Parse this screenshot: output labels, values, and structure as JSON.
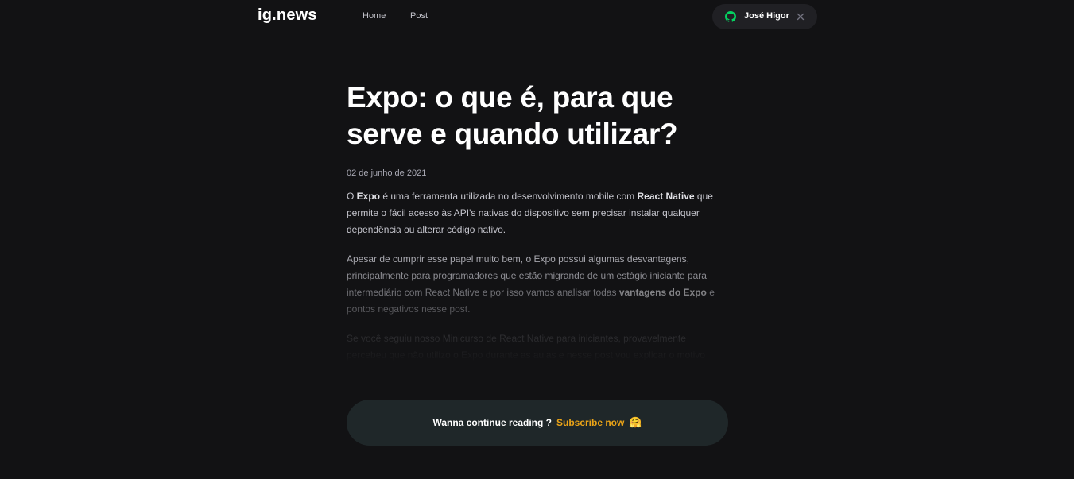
{
  "header": {
    "logo": "ig.news",
    "nav": [
      {
        "label": "Home"
      },
      {
        "label": "Post"
      }
    ],
    "user": {
      "name": "José Higor",
      "icon": "github-icon",
      "icon_color": "#04d361"
    }
  },
  "post": {
    "title": "Expo: o que é, para que serve e quando utilizar?",
    "date": "02 de junho de 2021",
    "paragraphs": {
      "p1": {
        "t1": "O ",
        "b1": "Expo",
        "t2": " é uma ferramenta utilizada no desenvolvimento mobile com ",
        "b2": "React Native",
        "t3": " que permite o fácil acesso às API's nativas do dispositivo sem precisar instalar qualquer dependência ou alterar código nativo."
      },
      "p2": {
        "t1": "Apesar de cumprir esse papel muito bem, o Expo possui algumas desvantagens, principalmente para programadores que estão migrando de um estágio iniciante para intermediário com React Native e por isso vamos analisar todas ",
        "b1": "vantagens do Expo",
        "t2": " e pontos negativos nesse post."
      },
      "p3": {
        "t1": "Se você seguiu nosso Minicurso de React Native para iniciantes, provavelmente percebeu que não utilizo o Expo durante as aulas e nesse post vou explicar o motivo disso."
      }
    }
  },
  "subscribe": {
    "text": "Wanna continue reading ?",
    "link": "Subscribe now",
    "emoji": "🤗",
    "accent": "#eba417"
  }
}
